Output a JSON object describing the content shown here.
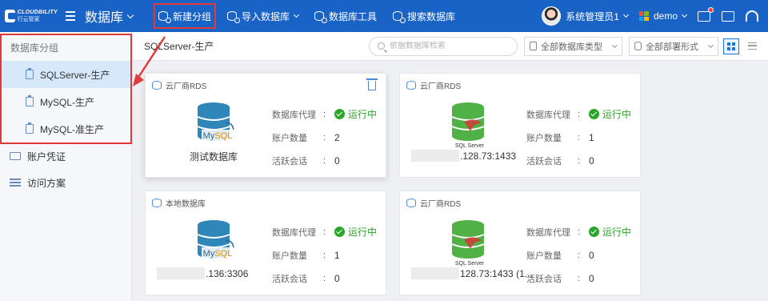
{
  "header": {
    "brand_top": "CLOUDBILITY",
    "brand_bottom": "行云管家",
    "module": "数据库",
    "menu": [
      {
        "label": "新建分组",
        "icon": "database-add-icon"
      },
      {
        "label": "导入数据库",
        "icon": "database-import-icon"
      },
      {
        "label": "数据库工具",
        "icon": "database-tools-icon"
      },
      {
        "label": "搜索数据库",
        "icon": "database-search-icon"
      }
    ],
    "user": "系统管理员1",
    "tenant": "demo"
  },
  "sidebar": {
    "group_title": "数据库分组",
    "groups": [
      {
        "label": "SQLServer-生产",
        "active": true
      },
      {
        "label": "MySQL-生产",
        "active": false
      },
      {
        "label": "MySQL-准生产",
        "active": false
      }
    ],
    "links": [
      {
        "label": "账户凭证",
        "icon": "credential-card-icon"
      },
      {
        "label": "访问方案",
        "icon": "access-plan-icon"
      }
    ]
  },
  "toolbar": {
    "breadcrumb": "SQLServer-生产",
    "search_placeholder": "依据数据库检索",
    "type_filter": "全部数据库类型",
    "deploy_filter": "全部部署形式"
  },
  "info_labels": {
    "proxy": "数据库代理",
    "accounts": "账户数量",
    "sessions": "活跃会话",
    "colon": ":"
  },
  "cards": [
    {
      "source": "云厂商RDS",
      "engine": "MySQL",
      "name": "测试数据库",
      "address": "",
      "status": "运行中",
      "accounts": "2",
      "sessions": "0",
      "selected": true
    },
    {
      "source": "云厂商RDS",
      "engine": "SQL Server",
      "name": "",
      "address": ".128.73:1433",
      "status": "运行中",
      "accounts": "1",
      "sessions": "0",
      "selected": false
    },
    {
      "source": "本地数据库",
      "engine": "MySQL",
      "name": "",
      "address": ".136:3306",
      "status": "运行中",
      "accounts": "1",
      "sessions": "0",
      "selected": false
    },
    {
      "source": "云厂商RDS",
      "engine": "SQL Server",
      "name": "",
      "address": "128.73:1433 (1...",
      "status": "运行中",
      "accounts": "0",
      "sessions": "0",
      "selected": false
    }
  ],
  "colors": {
    "primary": "#1a63c6",
    "success": "#2aa52a",
    "annotation": "#e23a3a"
  }
}
